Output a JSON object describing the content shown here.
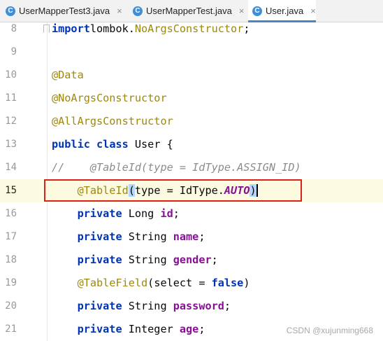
{
  "tabs": [
    {
      "label": "UserMapperTest3.java",
      "icon": "C",
      "close": "×"
    },
    {
      "label": "UserMapperTest.java",
      "icon": "C",
      "close": "×"
    },
    {
      "label": "User.java",
      "icon": "C",
      "close": "×",
      "active": true
    }
  ],
  "lines": [
    {
      "n": "8",
      "parts": [
        [
          "kw",
          "import"
        ],
        [
          "",
          "lombok."
        ],
        [
          "ann",
          "NoArgsConstructor"
        ],
        [
          "",
          ";"
        ]
      ]
    },
    {
      "n": "9",
      "parts": []
    },
    {
      "n": "10",
      "parts": [
        [
          "ann",
          "@Data"
        ]
      ]
    },
    {
      "n": "11",
      "parts": [
        [
          "ann",
          "@NoArgsConstructor"
        ]
      ]
    },
    {
      "n": "12",
      "parts": [
        [
          "ann",
          "@AllArgsConstructor"
        ]
      ]
    },
    {
      "n": "13",
      "parts": [
        [
          "kw",
          "public"
        ],
        [
          "",
          " "
        ],
        [
          "kw",
          "class"
        ],
        [
          "",
          " User {"
        ]
      ]
    },
    {
      "n": "14",
      "parts": [
        [
          "comment",
          "//    @TableId(type = IdType.ASSIGN_ID)"
        ]
      ]
    },
    {
      "n": "15",
      "current": true,
      "parts": [
        [
          "",
          "    "
        ],
        [
          "ann",
          "@TableId"
        ],
        [
          "bhl",
          "("
        ],
        [
          "",
          "type = IdType."
        ],
        [
          "konst",
          "AUTO"
        ],
        [
          "bhl caret",
          ")"
        ]
      ]
    },
    {
      "n": "16",
      "parts": [
        [
          "",
          "    "
        ],
        [
          "kw",
          "private"
        ],
        [
          "",
          " Long "
        ],
        [
          "field",
          "id"
        ],
        [
          "",
          ";"
        ]
      ]
    },
    {
      "n": "17",
      "parts": [
        [
          "",
          "    "
        ],
        [
          "kw",
          "private"
        ],
        [
          "",
          " String "
        ],
        [
          "field",
          "name"
        ],
        [
          "",
          ";"
        ]
      ]
    },
    {
      "n": "18",
      "parts": [
        [
          "",
          "    "
        ],
        [
          "kw",
          "private"
        ],
        [
          "",
          " String "
        ],
        [
          "field",
          "gender"
        ],
        [
          "",
          ";"
        ]
      ]
    },
    {
      "n": "19",
      "parts": [
        [
          "",
          "    "
        ],
        [
          "ann",
          "@TableField"
        ],
        [
          "",
          "(select = "
        ],
        [
          "kw",
          "false"
        ],
        [
          "",
          ")"
        ]
      ]
    },
    {
      "n": "20",
      "parts": [
        [
          "",
          "    "
        ],
        [
          "kw",
          "private"
        ],
        [
          "",
          " String "
        ],
        [
          "field",
          "password"
        ],
        [
          "",
          ";"
        ]
      ]
    },
    {
      "n": "21",
      "parts": [
        [
          "",
          "    "
        ],
        [
          "kw",
          "private"
        ],
        [
          "",
          " Integer "
        ],
        [
          "field",
          "age"
        ],
        [
          "",
          ";"
        ]
      ]
    }
  ],
  "watermark": "CSDN @xujunming668",
  "colors": {
    "keyword": "#0033b3",
    "annotation": "#9e880d",
    "field": "#871094",
    "comment": "#8c8c8c",
    "highlight": "#e0201a",
    "current_line": "#fcfae1",
    "tab_accent": "#4a86c7"
  }
}
